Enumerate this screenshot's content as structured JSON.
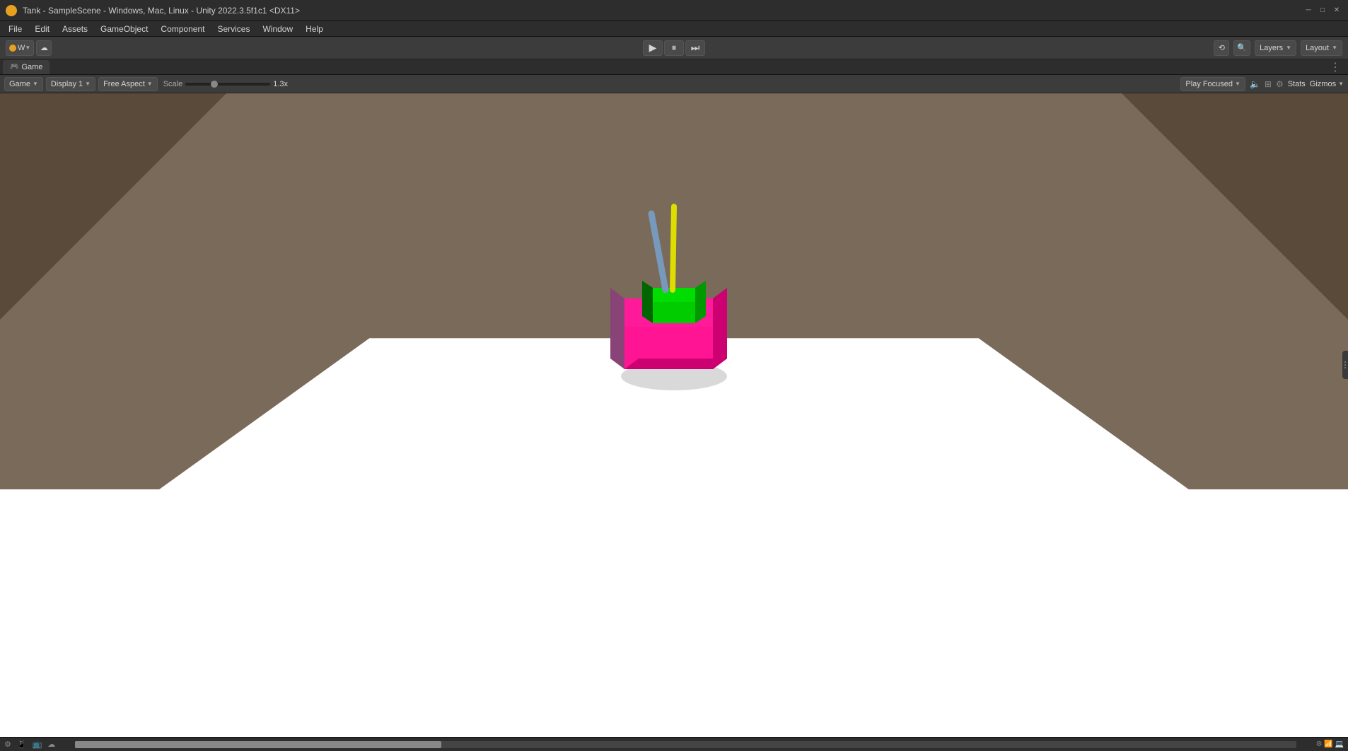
{
  "titlebar": {
    "text": "Tank - SampleScene - Windows, Mac, Linux - Unity 2022.3.5f1c1 <DX11>",
    "icon": "unity-logo"
  },
  "window_controls": {
    "minimize": "─",
    "maximize": "□",
    "close": "✕"
  },
  "menubar": {
    "items": [
      "File",
      "Edit",
      "Assets",
      "GameObject",
      "Component",
      "Services",
      "Window",
      "Help"
    ]
  },
  "toolbar": {
    "left": {
      "account_btn": "W",
      "cloud_btn": "☁"
    },
    "play_controls": {
      "play": "▶",
      "pause": "⏸",
      "step": "⏭"
    },
    "right": {
      "search_icon": "🔍",
      "layers_label": "Layers",
      "layout_label": "Layout",
      "history_icon": "⟲"
    }
  },
  "tabs": {
    "game_tab": {
      "icon": "🎮",
      "label": "Game"
    }
  },
  "game_toolbar": {
    "game_btn": "Game",
    "display_btn": "Display 1",
    "aspect_btn": "Free Aspect",
    "scale_label": "Scale",
    "scale_value": "1.3x",
    "play_focused_btn": "Play Focused",
    "stats_btn": "Stats",
    "gizmos_btn": "Gizmos"
  },
  "viewport": {
    "background_color": "#1e1e1e",
    "ground_color": "#ffffff",
    "tank": {
      "body_color": "#ff1493",
      "turret_color": "#00cc00",
      "barrel_color_main": "#cccc00",
      "barrel_color_alt": "#6688aa",
      "description": "A pink tank with green turret and yellow barrel"
    }
  },
  "bottom_bar": {
    "icons": [
      "⚙",
      "📱",
      "📺",
      "☁"
    ]
  }
}
